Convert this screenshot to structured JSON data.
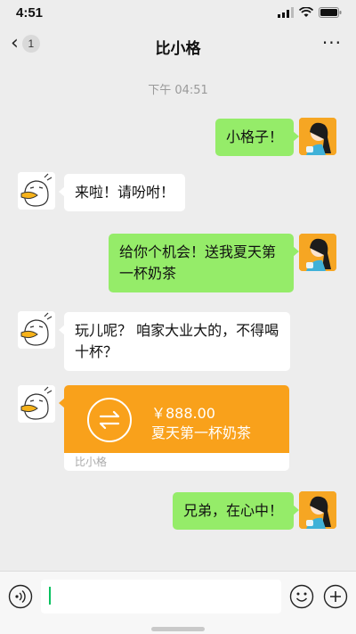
{
  "status_bar": {
    "time": "4:51",
    "icons": [
      "signal-icon",
      "wifi-icon",
      "battery-icon"
    ]
  },
  "nav": {
    "back_count": "1",
    "title": "比小格",
    "more_icon": "more-icon"
  },
  "timestamp": "下午 04:51",
  "messages": [
    {
      "side": "right",
      "text": "小格子！"
    },
    {
      "side": "left",
      "text": "来啦！请吩咐！"
    },
    {
      "side": "right",
      "text": "给你个机会！送我夏天第一杯奶茶"
    },
    {
      "side": "left",
      "text": "玩儿呢？ 咱家大业大的，不得喝十杯？"
    },
    {
      "side": "right",
      "text": "兄弟，在心中！"
    }
  ],
  "transfer": {
    "amount": "￥888.00",
    "description": "夏天第一杯奶茶",
    "footer": "比小格",
    "icon": "transfer-arrows-icon",
    "color": "#f9a11b"
  },
  "input_bar": {
    "value": "",
    "voice_icon": "voice-icon",
    "emoji_icon": "emoji-icon",
    "plus_icon": "plus-icon"
  },
  "colors": {
    "background": "#ededed",
    "my_bubble": "#95ec69",
    "their_bubble": "#ffffff",
    "accent": "#07c160"
  }
}
